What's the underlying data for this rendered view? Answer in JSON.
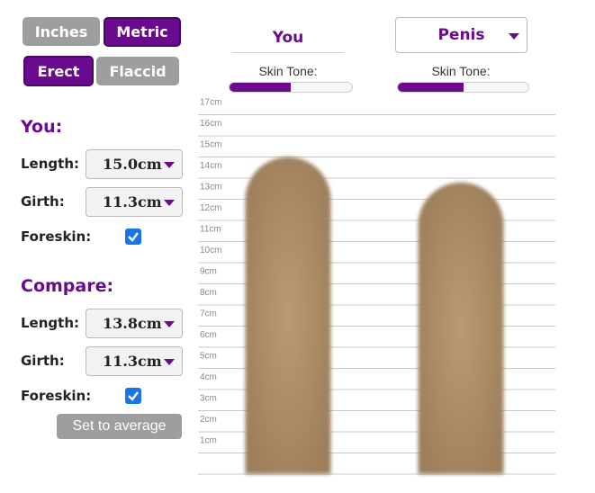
{
  "units": {
    "inches_label": "Inches",
    "metric_label": "Metric",
    "selected": "Metric"
  },
  "state": {
    "erect_label": "Erect",
    "flaccid_label": "Flaccid",
    "selected": "Erect"
  },
  "header": {
    "you_label": "You",
    "compare_select": {
      "selected": "Penis"
    },
    "skin_tone_label": "Skin Tone:",
    "you_skin_tone": 0.5,
    "compare_skin_tone": 0.5
  },
  "you": {
    "title": "You:",
    "length_label": "Length:",
    "length_value": "15.0cm",
    "girth_label": "Girth:",
    "girth_value": "11.3cm",
    "foreskin_label": "Foreskin:",
    "foreskin_checked": true
  },
  "compare": {
    "title": "Compare:",
    "length_label": "Length:",
    "length_value": "13.8cm",
    "girth_label": "Girth:",
    "girth_value": "11.3cm",
    "foreskin_label": "Foreskin:",
    "foreskin_checked": true,
    "average_button": "Set to average"
  },
  "chart_data": {
    "type": "bar",
    "categories": [
      "You",
      "Compare"
    ],
    "values": [
      15.0,
      13.8
    ],
    "unit": "cm",
    "ylim": [
      0,
      17
    ],
    "y_ticks": [
      "1cm",
      "2cm",
      "3cm",
      "4cm",
      "5cm",
      "6cm",
      "7cm",
      "8cm",
      "9cm",
      "10cm",
      "11cm",
      "12cm",
      "13cm",
      "14cm",
      "15cm",
      "16cm",
      "17cm"
    ],
    "grid": true,
    "colors": {
      "skin": "#b89a73",
      "grid": "#c8c8c8"
    }
  },
  "colors": {
    "accent": "#6a0b8f",
    "button_gray": "#9e9e9e",
    "checkbox": "#1a73e8"
  }
}
